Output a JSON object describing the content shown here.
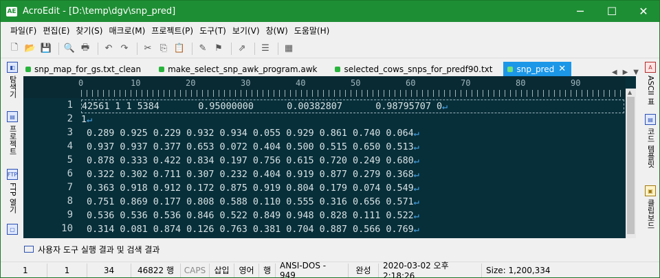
{
  "window": {
    "app_name": "AcroEdit",
    "title": "AcroEdit - [D:\\temp\\dgv\\snp_pred]",
    "min": "─",
    "max": "☐",
    "close": "✕"
  },
  "menu": [
    "파일(F)",
    "편집(E)",
    "찾기(S)",
    "매크로(M)",
    "프로젝트(P)",
    "도구(T)",
    "보기(V)",
    "창(W)",
    "도움말(H)"
  ],
  "left_sidebar": [
    "탐색기",
    "프로젝트",
    "FTP 열기"
  ],
  "right_sidebar": [
    "ASCII 표",
    "코드 템플릿",
    "클립보드"
  ],
  "tabs": [
    {
      "label": "snp_map_for_gs.txt_clean",
      "active": false
    },
    {
      "label": "make_select_snp_awk_program.awk",
      "active": false
    },
    {
      "label": "selected_cows_snps_for_predf90.txt",
      "active": false
    },
    {
      "label": "snp_pred",
      "active": true
    }
  ],
  "ruler": [
    "0",
    "10",
    "20",
    "30",
    "40",
    "50",
    "60",
    "70",
    "80",
    "90"
  ],
  "lines": [
    {
      "n": "1",
      "text": "42561 1 1 5384       0.95000000      0.00382807      0.98795707 0"
    },
    {
      "n": "2",
      "text": "1"
    },
    {
      "n": "3",
      "text": " 0.289 0.925 0.229 0.932 0.934 0.055 0.929 0.861 0.740 0.064"
    },
    {
      "n": "4",
      "text": " 0.937 0.937 0.377 0.653 0.072 0.404 0.500 0.515 0.650 0.513"
    },
    {
      "n": "5",
      "text": " 0.878 0.333 0.422 0.834 0.197 0.756 0.615 0.720 0.249 0.680"
    },
    {
      "n": "6",
      "text": " 0.322 0.302 0.711 0.307 0.232 0.404 0.919 0.877 0.279 0.368"
    },
    {
      "n": "7",
      "text": " 0.363 0.918 0.912 0.172 0.875 0.919 0.804 0.179 0.074 0.549"
    },
    {
      "n": "8",
      "text": " 0.751 0.869 0.177 0.808 0.588 0.110 0.555 0.316 0.656 0.571"
    },
    {
      "n": "9",
      "text": " 0.536 0.536 0.536 0.846 0.522 0.849 0.948 0.828 0.111 0.522"
    },
    {
      "n": "10",
      "text": " 0.314 0.081 0.874 0.126 0.763 0.381 0.704 0.887 0.566 0.769"
    }
  ],
  "eol_glyph": "↵",
  "bottom_panel": "사용자 도구 실행 결과 및 검색 결과",
  "status": [
    "1",
    "1",
    "34",
    "46822 행",
    "CAPS",
    "삽입",
    "영어",
    "행",
    "ANSI-DOS - 949",
    "완성",
    "2020-03-02 오후 2:18:26",
    "Size: 1,200,334"
  ]
}
